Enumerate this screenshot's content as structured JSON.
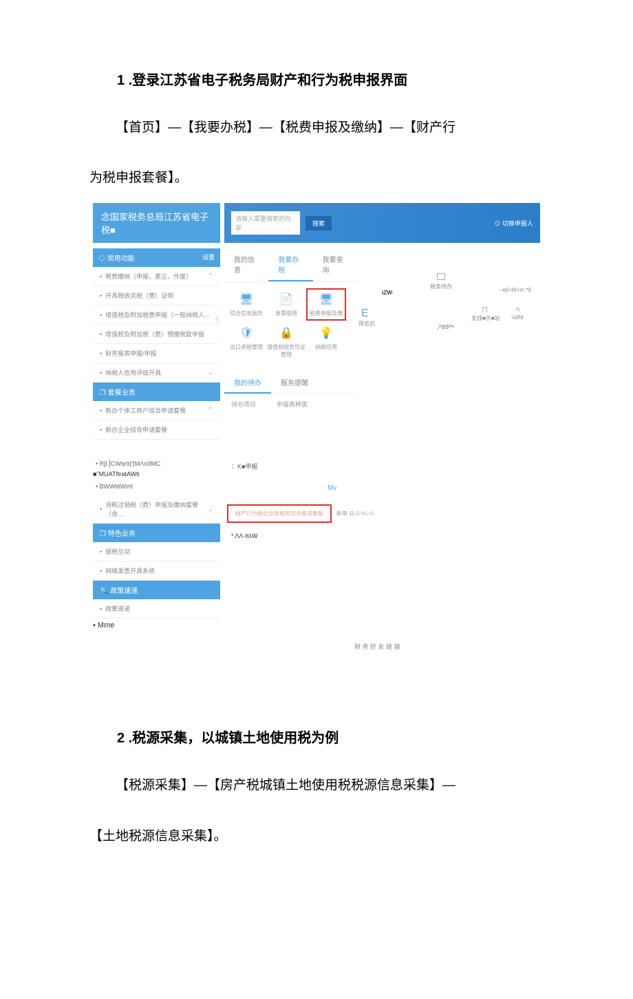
{
  "section1": {
    "heading": "1 .登录江苏省电子税务局财产和行为税申报界面",
    "instruction_line1": "【首页】—【我要办税】—【税费申报及缴纳】—【财产行",
    "instruction_line2": "为税申报套餐】。"
  },
  "embed1": {
    "banner_left": "念国家税务总局江苏省电子税■",
    "search_placeholder": "请输入需要搜索的内容",
    "search_btn": "搜索",
    "banner_user": "⊙ 切换申报人",
    "side_header": "◇ 常用功能",
    "side_header_gear": "设置",
    "side_items_top": [
      "税费缴纳（申报、更正、作废）",
      "开具税收完税（费）证明",
      "增值税及附加税费申报（一般纳税人…",
      "增值税及附加税（费）预缴税款申报",
      "财务报表申报/申报",
      "纳税人信用评级开具"
    ],
    "side_section2": "❐ 套餐业务",
    "side_items_mid": [
      "新办个体工商户综合申请套餐",
      "新办企业综合申请套餐"
    ],
    "tabs": [
      "我的信息",
      "我要办税",
      "我要查询"
    ],
    "icons_row1": [
      {
        "name": "monitor-icon",
        "label": "综合信息报告",
        "glyph": "🖥"
      },
      {
        "name": "document-icon",
        "label": "发票使用",
        "glyph": "📄"
      },
      {
        "name": "report-icon",
        "label": "税费申报及缴",
        "glyph": "🖥",
        "highlight": true
      }
    ],
    "icons_row2": [
      {
        "name": "shield-icon",
        "label": "出口退税管理",
        "glyph": "🛡"
      },
      {
        "name": "lock-icon",
        "label": "增值税税务凭证管理",
        "glyph": "🔒"
      },
      {
        "name": "bulb-icon",
        "label": "纳税信用",
        "glyph": "💡"
      }
    ],
    "subtabs": [
      "我的待办",
      "服务提醒"
    ],
    "subrow": [
      "待办项目",
      "申报表种类"
    ],
    "scatter": {
      "izw": "iZW·",
      "box_label": "税务待办",
      "ebm": "--eβ<M>m *9",
      "E": "E",
      "e_label": "预览后",
      "ss": ",^SS*^",
      "top_small": "[°]",
      "top_small2": "支线■示■站",
      "frac": "⅞",
      "tft": "⅛tft4"
    },
    "lower": {
      "lf_bullets": [
        "Rβ⎥CWte9∏MΛn9MC",
        "BWWtitWirtI"
      ],
      "lf_para": "■\"MUATftratAWti",
      "lf_items": [
        "消耗注销税（费）申报及缴纳套餐（含…"
      ],
      "lf_section_blue1": "❐ 特色业务",
      "lf_blue1_items": [
        "银税互动",
        "网络发票开具系统"
      ],
      "lf_section_blue2": "🔍 政策速递",
      "lf_blue2_items": [
        "政策速递"
      ],
      "kbar": "：K■申报",
      "mv": "Mv",
      "red_box": "财产行为税全业务税务综合集成套餐",
      "tiny": "新申 11-0-t¼-<｝",
      "footline": "* ΛΛ·ttλW",
      "mme": "• Mme",
      "friendly": "财 务 好 友 链 接"
    }
  },
  "section2": {
    "heading": "2 .税源采集，以城镇土地使用税为例",
    "instruction_line1": "【税源采集】—【房产税城镇土地使用税税源信息采集】—",
    "instruction_line2": "【土地税源信息采集】。"
  }
}
